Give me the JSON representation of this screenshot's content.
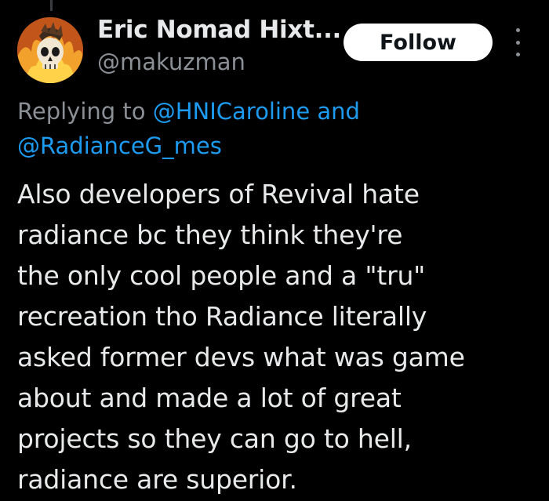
{
  "author": {
    "display_name": "Eric Nomad Hixt...",
    "handle": "@makuzman",
    "avatar_icon": "flaming-skull-avatar-icon"
  },
  "actions": {
    "follow_label": "Follow",
    "more_icon": "more-vertical-icon"
  },
  "reply_context": {
    "prefix": "Replying to ",
    "mention_1": "@HNICaroline",
    "joiner": " and",
    "mention_2": "@RadianceG_mes"
  },
  "tweet": {
    "lines": [
      "Also developers of Revival hate",
      "radiance bc they think they're",
      "the only cool people and a \"tru\"",
      "recreation tho Radiance literally",
      "asked former devs what was game",
      "about and made a lot of great",
      "projects so they can go to hell,",
      "radiance are superior."
    ]
  },
  "colors": {
    "background": "#000000",
    "primary_text": "#e7e9ea",
    "secondary_text": "#8b9096",
    "link": "#1d9bf0",
    "follow_button_bg": "#ffffff"
  }
}
